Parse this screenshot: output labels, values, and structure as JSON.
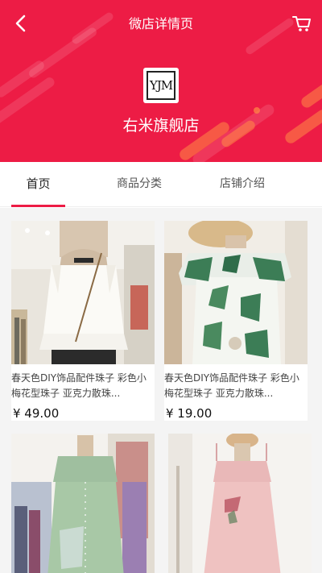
{
  "nav": {
    "title": "微店详情页",
    "back_icon": "chevron-left-icon",
    "cart_icon": "shopping-cart-icon"
  },
  "store": {
    "logo_text": "YJM",
    "name": "右米旗舰店"
  },
  "tabs": [
    {
      "label": "首页",
      "active": true
    },
    {
      "label": "商品分类",
      "active": false
    },
    {
      "label": "店铺介绍",
      "active": false
    }
  ],
  "products": [
    {
      "title": "春天色DIY饰品配件珠子 彩色小梅花型珠子 亚克力散珠...",
      "price": "¥ 49.00"
    },
    {
      "title": "春天色DIY饰品配件珠子 彩色小梅花型珠子 亚克力散珠...",
      "price": "¥ 19.00"
    },
    {
      "title": "",
      "price": ""
    },
    {
      "title": "",
      "price": ""
    }
  ],
  "colors": {
    "brand_red": "#ed1c45",
    "accent_orange": "#ff8c46"
  }
}
